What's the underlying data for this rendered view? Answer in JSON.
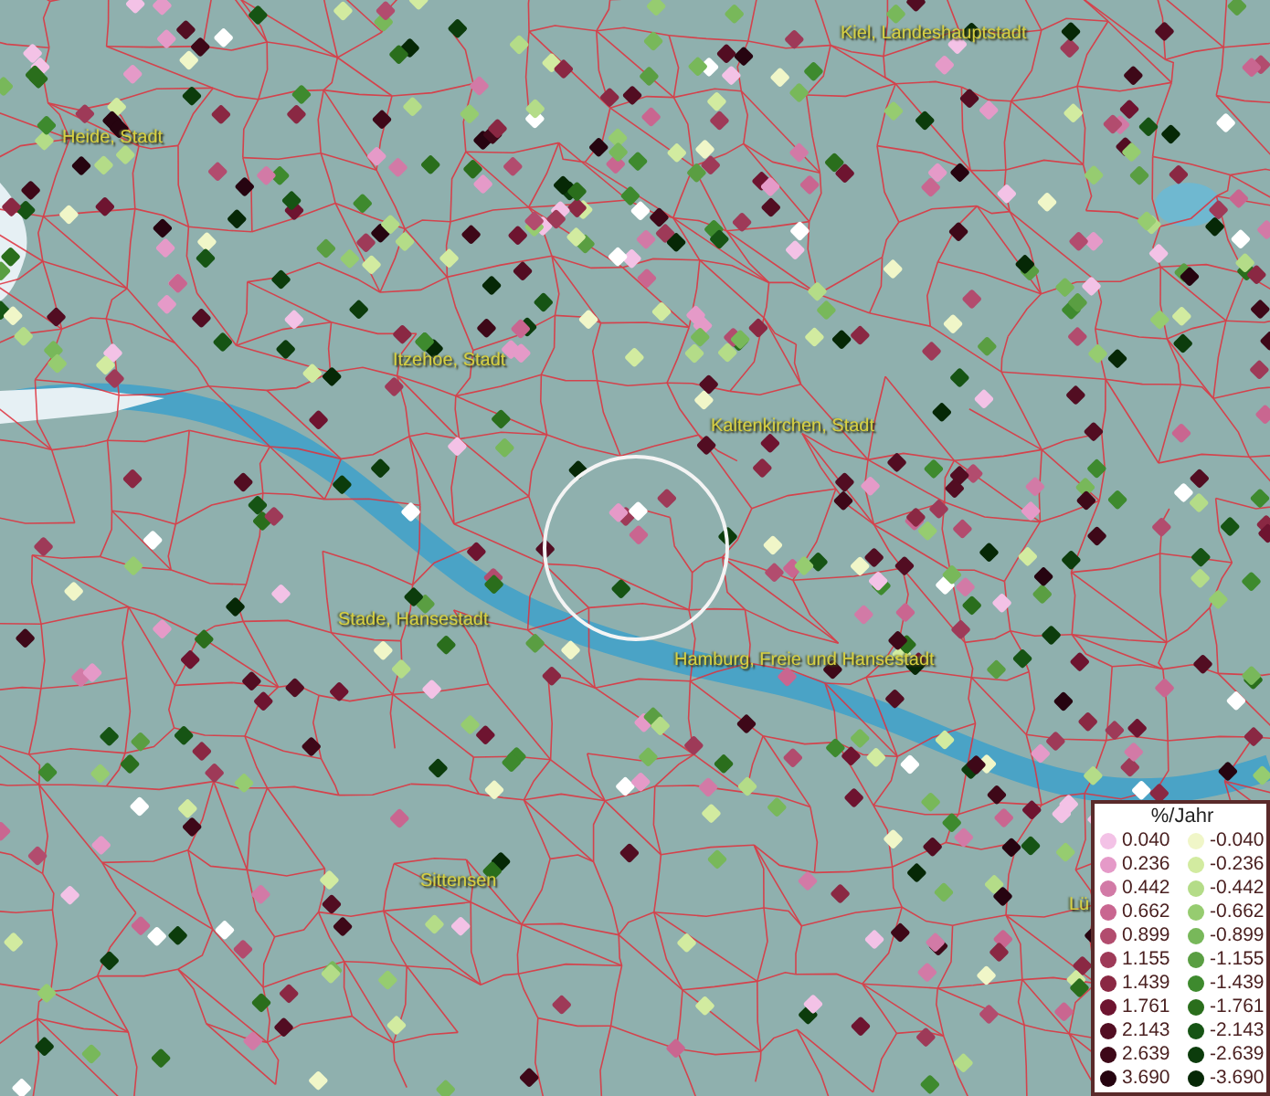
{
  "map": {
    "place_labels": [
      {
        "text": "Kiel, Landeshauptstadt"
      },
      {
        "text": "Heide, Stadt"
      },
      {
        "text": "Itzehoe, Stadt"
      },
      {
        "text": "Kaltenkirchen, Stadt"
      },
      {
        "text": "Stade, Hansestadt"
      },
      {
        "text": "Hamburg, Freie und Hansestadt"
      },
      {
        "text": "Sittensen"
      },
      {
        "text": "Lü"
      }
    ]
  },
  "legend": {
    "title": "%/Jahr",
    "rows": [
      {
        "positive": {
          "value": "0.040",
          "color": "#f3c2e6"
        },
        "negative": {
          "value": "-0.040",
          "color": "#f0f6c8"
        }
      },
      {
        "positive": {
          "value": "0.236",
          "color": "#e59ac8"
        },
        "negative": {
          "value": "-0.236",
          "color": "#d2eba0"
        }
      },
      {
        "positive": {
          "value": "0.442",
          "color": "#d27aa6"
        },
        "negative": {
          "value": "-0.442",
          "color": "#b4dc88"
        }
      },
      {
        "positive": {
          "value": "0.662",
          "color": "#c96690"
        },
        "negative": {
          "value": "-0.662",
          "color": "#96cc70"
        }
      },
      {
        "positive": {
          "value": "0.899",
          "color": "#b24c6e"
        },
        "negative": {
          "value": "-0.899",
          "color": "#78b85a"
        }
      },
      {
        "positive": {
          "value": "1.155",
          "color": "#9e3a58"
        },
        "negative": {
          "value": "-1.155",
          "color": "#5a9e42"
        }
      },
      {
        "positive": {
          "value": "1.439",
          "color": "#8a2843"
        },
        "negative": {
          "value": "-1.439",
          "color": "#3e8a2e"
        }
      },
      {
        "positive": {
          "value": "1.761",
          "color": "#6e1430"
        },
        "negative": {
          "value": "-1.761",
          "color": "#2a6e1c"
        }
      },
      {
        "positive": {
          "value": "2.143",
          "color": "#520d22"
        },
        "negative": {
          "value": "-2.143",
          "color": "#165414"
        }
      },
      {
        "positive": {
          "value": "2.639",
          "color": "#3e0818"
        },
        "negative": {
          "value": "-2.639",
          "color": "#0c3c0c"
        }
      },
      {
        "positive": {
          "value": "3.690",
          "color": "#260410"
        },
        "negative": {
          "value": "-3.690",
          "color": "#062806"
        }
      }
    ]
  }
}
